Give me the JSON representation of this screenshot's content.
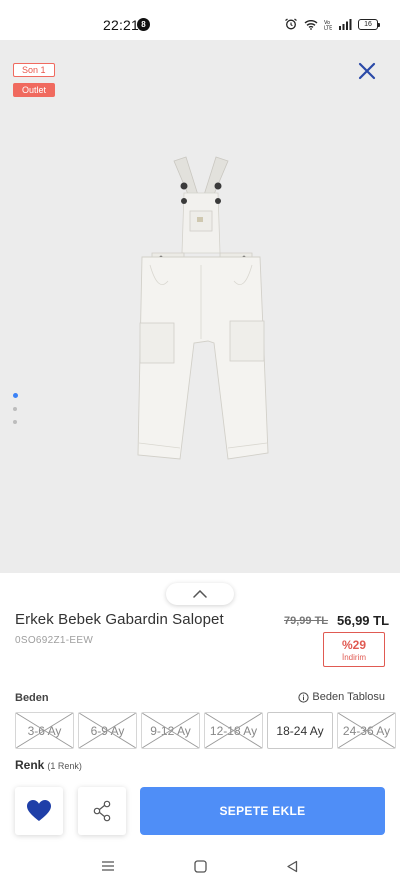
{
  "status_bar": {
    "time": "22:21",
    "notification_count": "8",
    "battery": "16"
  },
  "gallery": {
    "badges": [
      "Son 1",
      "Outlet"
    ],
    "image_count": 3,
    "active_index": 0
  },
  "product": {
    "title": "Erkek Bebek Gabardin Salopet",
    "sku": "0SO692Z1-EEW",
    "old_price": "79,99 TL",
    "price": "56,99 TL",
    "discount_percent": "%29",
    "discount_label": "İndirim"
  },
  "size": {
    "label": "Beden",
    "chart_link": "Beden Tablosu",
    "options": [
      {
        "label": "3-6 Ay",
        "available": false
      },
      {
        "label": "6-9 Ay",
        "available": false
      },
      {
        "label": "9-12 Ay",
        "available": false
      },
      {
        "label": "12-18 Ay",
        "available": false
      },
      {
        "label": "18-24 Ay",
        "available": true
      },
      {
        "label": "24-36 Ay",
        "available": false
      }
    ]
  },
  "color": {
    "label": "Renk",
    "count": "(1 Renk)"
  },
  "actions": {
    "add_to_cart": "SEPETE EKLE"
  },
  "colors": {
    "accent": "#4f8ef7",
    "heart": "#1f3fa8",
    "sale": "#f06a5f",
    "close": "#2b4aa8"
  }
}
